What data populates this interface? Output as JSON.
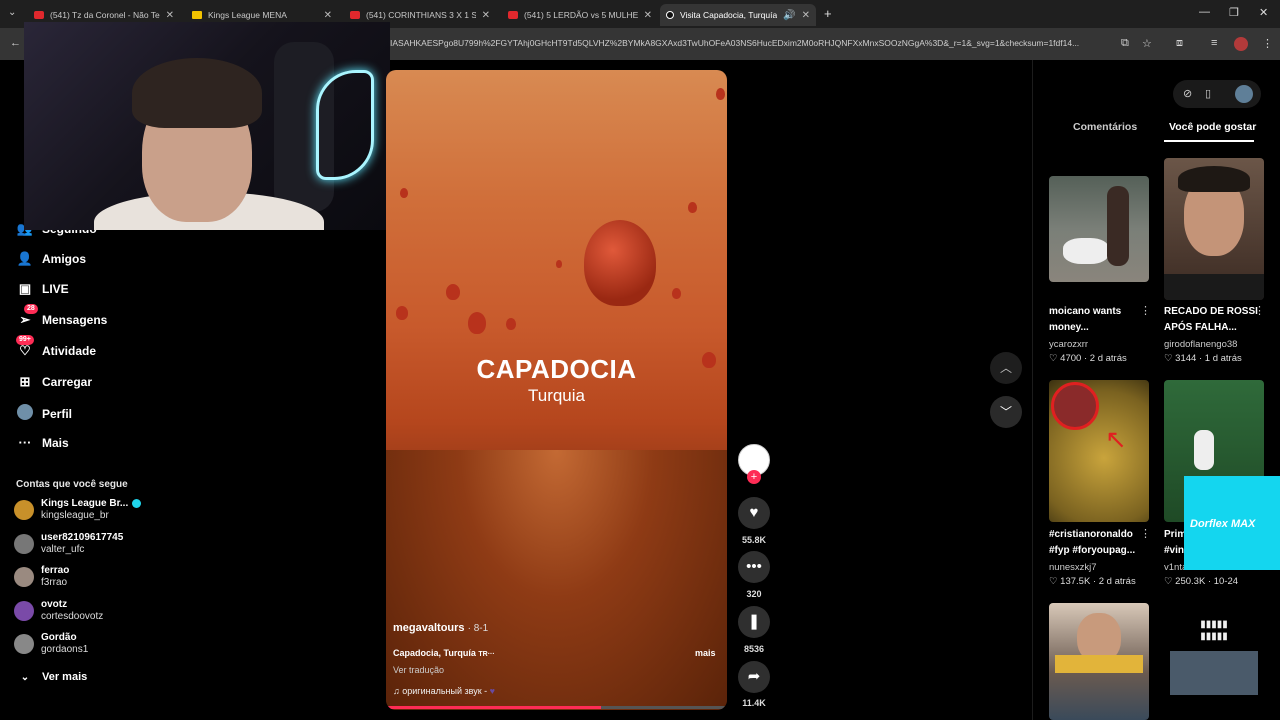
{
  "browser": {
    "tabs": [
      {
        "label": "(541) Tz da Coronel - Não Temo"
      },
      {
        "label": "Kings League MENA"
      },
      {
        "label": "(541) CORINTHIANS 3 X 1 SÃO"
      },
      {
        "label": "(541) 5 LERDÃO vs 5 MULHERE"
      },
      {
        "label": "Visita Capadocia, Turquía:"
      }
    ],
    "url": "IASAHKAESPgo8U799h%2FGYTAhj0GHcHT9Td5QLVHZ%2BYMkA8GXAxd3TwUhOFeA03NS6HucEDxim2M0oRHJQNFXxMnxSOOzNGgA%3D&_r=1&_svg=1&checksum=1fdf14..."
  },
  "sidebar": {
    "items": [
      {
        "label": "Seguindo",
        "icon": "following-icon"
      },
      {
        "label": "Amigos",
        "icon": "friends-icon"
      },
      {
        "label": "LIVE",
        "icon": "live-icon"
      },
      {
        "label": "Mensagens",
        "icon": "messages-icon",
        "badge": "28"
      },
      {
        "label": "Atividade",
        "icon": "activity-icon",
        "badge": "99+"
      },
      {
        "label": "Carregar",
        "icon": "upload-icon"
      },
      {
        "label": "Perfil",
        "icon": "profile-icon"
      },
      {
        "label": "Mais",
        "icon": "more-icon"
      }
    ],
    "following_title": "Contas que você segue",
    "accounts": [
      {
        "name": "Kings League Br...",
        "handle": "kingsleague_br",
        "verified": true,
        "color": "#c8902a"
      },
      {
        "name": "user82109617745",
        "handle": "valter_ufc",
        "color": "#777777"
      },
      {
        "name": "ferrao",
        "handle": "f3rrao",
        "color": "#9a8a80"
      },
      {
        "name": "ovotz",
        "handle": "cortesdoovotz",
        "color": "#7a4aa8"
      },
      {
        "name": "Gordão",
        "handle": "gordaons1",
        "color": "#888888"
      }
    ],
    "see_more": "Ver mais"
  },
  "video": {
    "overlay_title": "CAPADOCIA",
    "overlay_subtitle": "Turquia",
    "author": "megavaltours",
    "date": "· 8-1",
    "description": "Capadocia, Turquía",
    "more": "mais",
    "translate": "Ver tradução",
    "sound": "оригинальный звук -",
    "progress": 0.63
  },
  "actions": {
    "likes": "55.8K",
    "comments": "320",
    "saves": "8536",
    "shares": "11.4K"
  },
  "right_panel": {
    "tabs": {
      "comments": "Comentários",
      "for_you": "Você pode gostar"
    },
    "videos": [
      {
        "title": "moicano wants\nmoney...",
        "user": "ycarozxrr",
        "likes": "4700",
        "age": "2 d atrás"
      },
      {
        "title": "RECADO DE ROSSI\nAPÓS FALHA...",
        "user": "girodoflanengo38",
        "likes": "3144",
        "age": "1 d atrás"
      },
      {
        "title": "#cristianoronaldo\n#fyp #foryoupag...",
        "user": "nunesxzkj7",
        "likes": "137.5K",
        "age": "2 d atrás"
      },
      {
        "title": "Prim\n#vin",
        "user": "v1nta",
        "likes": "250.3K",
        "age": "10-24"
      }
    ],
    "ad_text": "Dorflex MAX"
  }
}
